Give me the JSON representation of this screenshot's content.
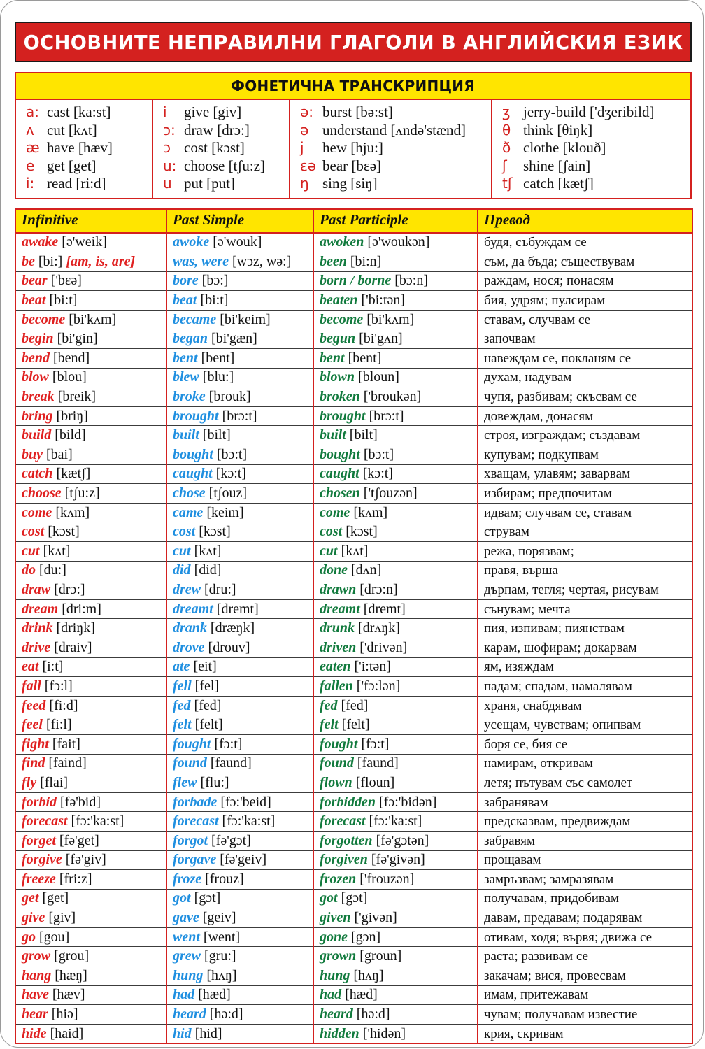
{
  "title": "ОСНОВНИТЕ НЕПРАВИЛНИ ГЛАГОЛИ В АНГЛИЙСКИЯ ЕЗИК",
  "phonetic": {
    "heading": "ФОНЕТИЧНА ТРАНСКРИПЦИЯ",
    "columns": [
      [
        {
          "symbol": "a:",
          "example": "cast [ka:st]"
        },
        {
          "symbol": "ʌ",
          "example": "cut [kʌt]"
        },
        {
          "symbol": "æ",
          "example": "have [hæv]"
        },
        {
          "symbol": "e",
          "example": "get [get]"
        },
        {
          "symbol": "i:",
          "example": "read [ri:d]"
        }
      ],
      [
        {
          "symbol": "i",
          "example": "give [giv]"
        },
        {
          "symbol": "ɔ:",
          "example": "draw [drɔ:]"
        },
        {
          "symbol": "ɔ",
          "example": "cost [kɔst]"
        },
        {
          "symbol": "u:",
          "example": "choose [tʃu:z]"
        },
        {
          "symbol": "u",
          "example": "put [put]"
        }
      ],
      [
        {
          "symbol": "ə:",
          "example": "burst [bə:st]"
        },
        {
          "symbol": "ə",
          "example": "understand [ʌndə'stænd]"
        },
        {
          "symbol": "j",
          "example": "hew [hju:]"
        },
        {
          "symbol": "εə",
          "example": "bear [bεə]"
        },
        {
          "symbol": "ŋ",
          "example": "sing [siŋ]"
        }
      ],
      [
        {
          "symbol": "ʒ",
          "example": "jerry-build ['dʒeribild]"
        },
        {
          "symbol": "θ",
          "example": "think [θiŋk]"
        },
        {
          "symbol": "ð",
          "example": "clothe [klouð]"
        },
        {
          "symbol": "ʃ",
          "example": "shine [ʃain]"
        },
        {
          "symbol": "tʃ",
          "example": "catch [kætʃ]"
        }
      ]
    ]
  },
  "table": {
    "headers": [
      "Infinitive",
      "Past Simple",
      "Past Participle",
      "Превод"
    ],
    "colors": {
      "infinitive": "#e02020",
      "past_simple": "#1f8fe0",
      "past_participle": "#117a3d",
      "translation": "#111111",
      "header_bg": "#ffe500",
      "title_bg": "#d4211f",
      "border": "#d4211f"
    },
    "rows": [
      {
        "inf_w": "awake",
        "inf_p": "[ə'weik]",
        "inf_alt": "",
        "ps_w": "awoke",
        "ps_p": "[ə'wouk]",
        "pp_w": "awoken",
        "pp_p": "[ə'woukən]",
        "tr": "будя, събуждам се"
      },
      {
        "inf_w": "be",
        "inf_p": "[bi:]",
        "inf_alt": "[am, is, are]",
        "ps_w": "was, were",
        "ps_p": "[wɔz, wə:]",
        "pp_w": "been",
        "pp_p": "[bi:n]",
        "tr": "съм, да бъда; съществувам"
      },
      {
        "inf_w": "bear",
        "inf_p": "['bεə]",
        "inf_alt": "",
        "ps_w": "bore",
        "ps_p": "[bɔ:]",
        "pp_w": "born / borne",
        "pp_p": "[bɔ:n]",
        "tr": "раждам, нося; понасям"
      },
      {
        "inf_w": "beat",
        "inf_p": "[bi:t]",
        "inf_alt": "",
        "ps_w": "beat",
        "ps_p": "[bi:t]",
        "pp_w": "beaten",
        "pp_p": "['bi:tən]",
        "tr": "бия, удрям; пулсирам"
      },
      {
        "inf_w": "become",
        "inf_p": "[bi'kʌm]",
        "inf_alt": "",
        "ps_w": "became",
        "ps_p": "[bi'keim]",
        "pp_w": "become",
        "pp_p": "[bi'kʌm]",
        "tr": "ставам, случвам се"
      },
      {
        "inf_w": "begin",
        "inf_p": "[bi'gin]",
        "inf_alt": "",
        "ps_w": "began",
        "ps_p": "[bi'gæn]",
        "pp_w": "begun",
        "pp_p": "[bi'gʌn]",
        "tr": "започвам"
      },
      {
        "inf_w": "bend",
        "inf_p": "[bend]",
        "inf_alt": "",
        "ps_w": "bent",
        "ps_p": "[bent]",
        "pp_w": "bent",
        "pp_p": "[bent]",
        "tr": "навеждам се, покланям се"
      },
      {
        "inf_w": "blow",
        "inf_p": "[blou]",
        "inf_alt": "",
        "ps_w": "blew",
        "ps_p": "[blu:]",
        "pp_w": "blown",
        "pp_p": "[bloun]",
        "tr": "духам, надувам"
      },
      {
        "inf_w": "break",
        "inf_p": "[breik]",
        "inf_alt": "",
        "ps_w": "broke",
        "ps_p": "[brouk]",
        "pp_w": "broken",
        "pp_p": "['broukən]",
        "tr": "чупя, разбивам; скъсвам се"
      },
      {
        "inf_w": "bring",
        "inf_p": "[briŋ]",
        "inf_alt": "",
        "ps_w": "brought",
        "ps_p": "[brɔ:t]",
        "pp_w": "brought",
        "pp_p": "[brɔ:t]",
        "tr": "довеждам, донасям"
      },
      {
        "inf_w": "build",
        "inf_p": "[bild]",
        "inf_alt": "",
        "ps_w": "built",
        "ps_p": "[bilt]",
        "pp_w": "built",
        "pp_p": "[bilt]",
        "tr": "строя, изграждам; създавам"
      },
      {
        "inf_w": "buy",
        "inf_p": "[bai]",
        "inf_alt": "",
        "ps_w": "bought",
        "ps_p": "[bɔ:t]",
        "pp_w": "bought",
        "pp_p": "[bɔ:t]",
        "tr": "купувам; подкупвам"
      },
      {
        "inf_w": "catch",
        "inf_p": "[kætʃ]",
        "inf_alt": "",
        "ps_w": "caught",
        "ps_p": "[kɔ:t]",
        "pp_w": "caught",
        "pp_p": "[kɔ:t]",
        "tr": "хващам, улавям; заварвам"
      },
      {
        "inf_w": "choose",
        "inf_p": "[tʃu:z]",
        "inf_alt": "",
        "ps_w": "chose",
        "ps_p": "[tʃouz]",
        "pp_w": "chosen",
        "pp_p": "['tʃouzən]",
        "tr": "избирам; предпочитам"
      },
      {
        "inf_w": "come",
        "inf_p": "[kʌm]",
        "inf_alt": "",
        "ps_w": "came",
        "ps_p": "[keim]",
        "pp_w": "come",
        "pp_p": "[kʌm]",
        "tr": "идвам; случвам се, ставам"
      },
      {
        "inf_w": "cost",
        "inf_p": "[kɔst]",
        "inf_alt": "",
        "ps_w": "cost",
        "ps_p": "[kɔst]",
        "pp_w": "cost",
        "pp_p": "[kɔst]",
        "tr": "струвам"
      },
      {
        "inf_w": "cut",
        "inf_p": "[kʌt]",
        "inf_alt": "",
        "ps_w": "cut",
        "ps_p": "[kʌt]",
        "pp_w": "cut",
        "pp_p": "[kʌt]",
        "tr": "режа, порязвам;"
      },
      {
        "inf_w": "do",
        "inf_p": "[du:]",
        "inf_alt": "",
        "ps_w": "did",
        "ps_p": "[did]",
        "pp_w": "done",
        "pp_p": "[dʌn]",
        "tr": "правя, върша"
      },
      {
        "inf_w": "draw",
        "inf_p": "[drɔ:]",
        "inf_alt": "",
        "ps_w": "drew",
        "ps_p": "[dru:]",
        "pp_w": "drawn",
        "pp_p": "[drɔ:n]",
        "tr": "дърпам, тегля; чертая, рисувам"
      },
      {
        "inf_w": "dream",
        "inf_p": "[dri:m]",
        "inf_alt": "",
        "ps_w": "dreamt",
        "ps_p": "[dremt]",
        "pp_w": "dreamt",
        "pp_p": "[dremt]",
        "tr": "сънувам; мечта"
      },
      {
        "inf_w": "drink",
        "inf_p": "[driŋk]",
        "inf_alt": "",
        "ps_w": "drank",
        "ps_p": "[dræŋk]",
        "pp_w": "drunk",
        "pp_p": "[drʌŋk]",
        "tr": "пия, изпивам; пиянствам"
      },
      {
        "inf_w": "drive",
        "inf_p": "[draiv]",
        "inf_alt": "",
        "ps_w": "drove",
        "ps_p": "[drouv]",
        "pp_w": "driven",
        "pp_p": "['drivən]",
        "tr": "карам, шофирам; докарвам"
      },
      {
        "inf_w": "eat",
        "inf_p": "[i:t]",
        "inf_alt": "",
        "ps_w": "ate",
        "ps_p": "[eit]",
        "pp_w": "eaten",
        "pp_p": "['i:tən]",
        "tr": "ям, изяждам"
      },
      {
        "inf_w": "fall",
        "inf_p": "[fɔ:l]",
        "inf_alt": "",
        "ps_w": "fell",
        "ps_p": "[fel]",
        "pp_w": "fallen",
        "pp_p": "['fɔ:lən]",
        "tr": "падам; спадам, намалявам"
      },
      {
        "inf_w": "feed",
        "inf_p": "[fi:d]",
        "inf_alt": "",
        "ps_w": "fed",
        "ps_p": "[fed]",
        "pp_w": "fed",
        "pp_p": "[fed]",
        "tr": "храня, снабдявам"
      },
      {
        "inf_w": "feel",
        "inf_p": "[fi:l]",
        "inf_alt": "",
        "ps_w": "felt",
        "ps_p": "[felt]",
        "pp_w": "felt",
        "pp_p": "[felt]",
        "tr": "усещам, чувствам; опипвам"
      },
      {
        "inf_w": "fight",
        "inf_p": "[fait]",
        "inf_alt": "",
        "ps_w": "fought",
        "ps_p": "[fɔ:t]",
        "pp_w": "fought",
        "pp_p": "[fɔ:t]",
        "tr": "боря се, бия се"
      },
      {
        "inf_w": "find",
        "inf_p": "[faind]",
        "inf_alt": "",
        "ps_w": "found",
        "ps_p": "[faund]",
        "pp_w": "found",
        "pp_p": "[faund]",
        "tr": "намирам, откривам"
      },
      {
        "inf_w": "fly",
        "inf_p": "[flai]",
        "inf_alt": "",
        "ps_w": "flew",
        "ps_p": "[flu:]",
        "pp_w": "flown",
        "pp_p": "[floun]",
        "tr": "летя; пътувам със самолет"
      },
      {
        "inf_w": "forbid",
        "inf_p": "[fə'bid]",
        "inf_alt": "",
        "ps_w": "forbade",
        "ps_p": "[fɔ:'beid]",
        "pp_w": "forbidden",
        "pp_p": "[fɔ:'bidən]",
        "tr": "забранявам"
      },
      {
        "inf_w": "forecast",
        "inf_p": "[fɔ:'ka:st]",
        "inf_alt": "",
        "ps_w": "forecast",
        "ps_p": "[fɔ:'ka:st]",
        "pp_w": "forecast",
        "pp_p": "[fɔ:'ka:st]",
        "tr": "предсказвам, предвиждам"
      },
      {
        "inf_w": "forget",
        "inf_p": "[fə'get]",
        "inf_alt": "",
        "ps_w": "forgot",
        "ps_p": "[fə'gɔt]",
        "pp_w": "forgotten",
        "pp_p": "[fə'gɔtən]",
        "tr": "забравям"
      },
      {
        "inf_w": "forgive",
        "inf_p": "[fə'giv]",
        "inf_alt": "",
        "ps_w": "forgave",
        "ps_p": "[fə'geiv]",
        "pp_w": "forgiven",
        "pp_p": "[fə'givən]",
        "tr": "прощавам"
      },
      {
        "inf_w": "freeze",
        "inf_p": "[fri:z]",
        "inf_alt": "",
        "ps_w": "froze",
        "ps_p": "[frouz]",
        "pp_w": "frozen",
        "pp_p": "['frouzən]",
        "tr": "замръзвам; замразявам"
      },
      {
        "inf_w": "get",
        "inf_p": "[get]",
        "inf_alt": "",
        "ps_w": "got",
        "ps_p": "[gɔt]",
        "pp_w": "got",
        "pp_p": "[gɔt]",
        "tr": "получавам, придобивам"
      },
      {
        "inf_w": "give",
        "inf_p": "[giv]",
        "inf_alt": "",
        "ps_w": "gave",
        "ps_p": "[geiv]",
        "pp_w": "given",
        "pp_p": "['givən]",
        "tr": "давам, предавам; подарявам"
      },
      {
        "inf_w": "go",
        "inf_p": "[gou]",
        "inf_alt": "",
        "ps_w": "went",
        "ps_p": "[went]",
        "pp_w": "gone",
        "pp_p": "[gɔn]",
        "tr": "отивам, ходя; вървя; движа се"
      },
      {
        "inf_w": "grow",
        "inf_p": "[grou]",
        "inf_alt": "",
        "ps_w": "grew",
        "ps_p": "[gru:]",
        "pp_w": "grown",
        "pp_p": "[groun]",
        "tr": "раста; развивам се"
      },
      {
        "inf_w": "hang",
        "inf_p": "[hæŋ]",
        "inf_alt": "",
        "ps_w": "hung",
        "ps_p": "[hʌŋ]",
        "pp_w": "hung",
        "pp_p": "[hʌŋ]",
        "tr": "закачам; вися, провесвам"
      },
      {
        "inf_w": "have",
        "inf_p": "[hæv]",
        "inf_alt": "",
        "ps_w": "had",
        "ps_p": "[hæd]",
        "pp_w": "had",
        "pp_p": "[hæd]",
        "tr": "имам, притежавам"
      },
      {
        "inf_w": "hear",
        "inf_p": "[hiə]",
        "inf_alt": "",
        "ps_w": "heard",
        "ps_p": "[hə:d]",
        "pp_w": "heard",
        "pp_p": "[hə:d]",
        "tr": "чувам; получавам известие"
      },
      {
        "inf_w": "hide",
        "inf_p": "[haid]",
        "inf_alt": "",
        "ps_w": "hid",
        "ps_p": "[hid]",
        "pp_w": "hidden",
        "pp_p": "['hidən]",
        "tr": "крия, скривам"
      }
    ]
  }
}
